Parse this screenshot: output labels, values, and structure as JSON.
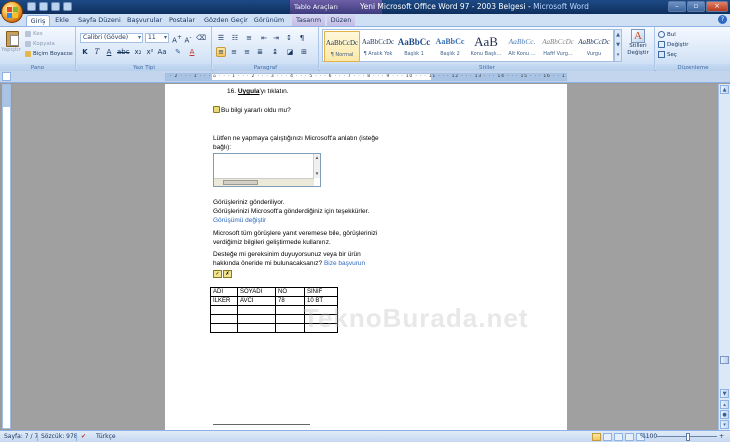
{
  "window": {
    "title": "Yeni Microsoft Office Word 97 - 2003 Belgesi",
    "app_name": "Microsoft Word",
    "tool_tab_title": "Tablo Araçları",
    "title_separator": " - "
  },
  "tabs": [
    {
      "label": "Giriş",
      "active": true
    },
    {
      "label": "Ekle"
    },
    {
      "label": "Sayfa Düzeni"
    },
    {
      "label": "Başvurular"
    },
    {
      "label": "Postalar"
    },
    {
      "label": "Gözden Geçir"
    },
    {
      "label": "Görünüm"
    },
    {
      "label": "Tasarım",
      "tool": true
    },
    {
      "label": "Düzen",
      "tool": true
    }
  ],
  "ribbon": {
    "clipboard": {
      "label": "Pano",
      "paste": "Yapıştır",
      "cut": "Kes",
      "copy": "Kopyala",
      "format_painter": "Biçim Boyacısı"
    },
    "font": {
      "label": "Yazı Tipi",
      "font_name": "Calibri (Gövde)",
      "font_size": "11"
    },
    "paragraph": {
      "label": "Paragraf"
    },
    "styles": {
      "label": "Stiller",
      "items": [
        {
          "preview": "AaBbCcDc",
          "name": "¶ Normal",
          "active": true
        },
        {
          "preview": "AaBbCcDc",
          "name": "¶ Aralık Yok"
        },
        {
          "preview": "AaBbCc",
          "name": "Başlık 1"
        },
        {
          "preview": "AaBbCc",
          "name": "Başlık 2"
        },
        {
          "preview": "AaB",
          "name": "Konu Başlı..."
        },
        {
          "preview": "AaBbCc.",
          "name": "Alt Konu ..."
        },
        {
          "preview": "AaBbCcDc",
          "name": "Hafif Vurg..."
        },
        {
          "preview": "AaBbCcDc",
          "name": "Vurgu"
        }
      ],
      "change_styles": "Stilleri Değiştir"
    },
    "editing": {
      "label": "Düzenleme",
      "find": "Bul",
      "replace": "Değiştir",
      "select": "Seç"
    }
  },
  "document": {
    "step16": "16. ",
    "step16_bold": "Uygula",
    "step16_rest": "'yı tıklatın.",
    "helpful_question": "Bu bilgi yararlı oldu mu?",
    "feedback_prompt_1": " Lütfen ne yapmaya çalıştığınızı Microsoft'a anlatın (isteğe",
    "feedback_prompt_2": "bağlı):",
    "sent_1": "Görüşleriniz gönderiliyor.",
    "sent_2": "Görüşlerinizi Microsoft'a gönderdiğiniz için teşekkürler.",
    "change_link": "Görüşümü değiştir",
    "note_1": "Microsoft tüm görüşlere yanıt veremese bile, görüşlerinizi",
    "note_2": "verdiğimiz bilgileri geliştirmede kullanırız.",
    "support_1": "Desteğe mi gereksinim duyuyorsunuz veya bir ürün",
    "support_2": "hakkında öneride mi bulunacaksanız? ",
    "support_link": "Bize başvurun",
    "table": {
      "rows": [
        [
          "ADI",
          "SOYADI",
          "NO",
          "SINIF"
        ],
        [
          "İLKER",
          "AVCI",
          "78",
          "10 BT"
        ],
        [
          "",
          "",
          "",
          ""
        ],
        [
          "",
          "",
          "",
          ""
        ],
        [
          "",
          "",
          "",
          ""
        ]
      ]
    },
    "watermark": "TeknoBurada.net"
  },
  "status": {
    "page": "Sayfa: 7 / 7",
    "words": "Sözcük: 978",
    "language": "Türkçe",
    "zoom": "%100"
  },
  "colors": {
    "accent": "#1d4a86",
    "link": "#2b68c1",
    "ribbon_bg": "#dbe8f8"
  }
}
